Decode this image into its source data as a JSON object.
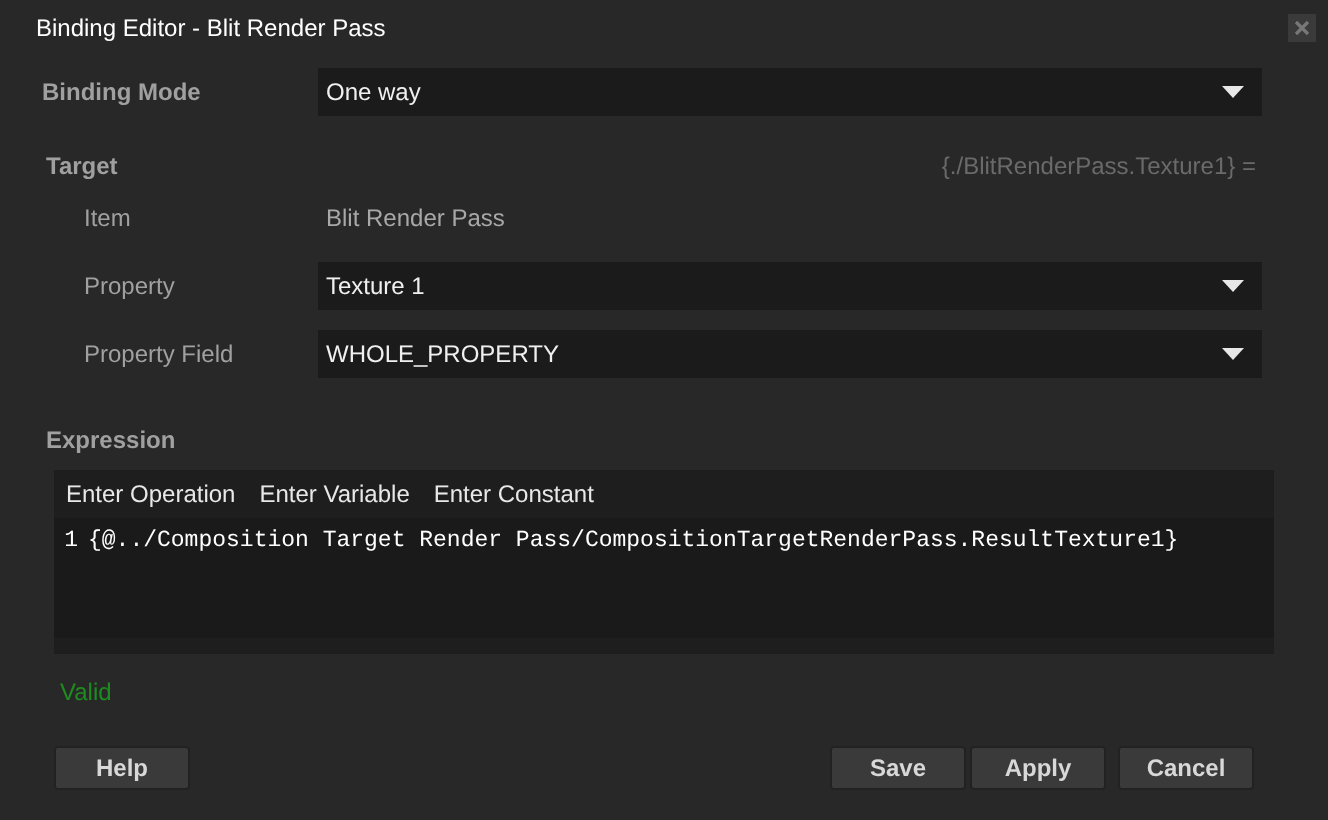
{
  "window": {
    "title": "Binding Editor - Blit Render Pass"
  },
  "binding_mode": {
    "label": "Binding Mode",
    "value": "One way"
  },
  "target": {
    "label": "Target",
    "preview": "{./BlitRenderPass.Texture1} =",
    "rows": [
      {
        "kind": "text",
        "label": "Item",
        "value": "Blit Render Pass"
      },
      {
        "kind": "dropdown",
        "label": "Property",
        "value": "Texture 1"
      },
      {
        "kind": "dropdown",
        "label": "Property Field",
        "value": "WHOLE_PROPERTY"
      }
    ]
  },
  "expression": {
    "label": "Expression",
    "toolbar": [
      "Enter Operation",
      "Enter Variable",
      "Enter Constant"
    ],
    "lines": [
      {
        "number": "1",
        "text": "{@../Composition Target Render Pass/CompositionTargetRenderPass.ResultTexture1}"
      }
    ]
  },
  "status": "Valid",
  "buttons": {
    "left": [
      "Help"
    ],
    "right": [
      "Save",
      "Apply",
      "Cancel"
    ]
  }
}
